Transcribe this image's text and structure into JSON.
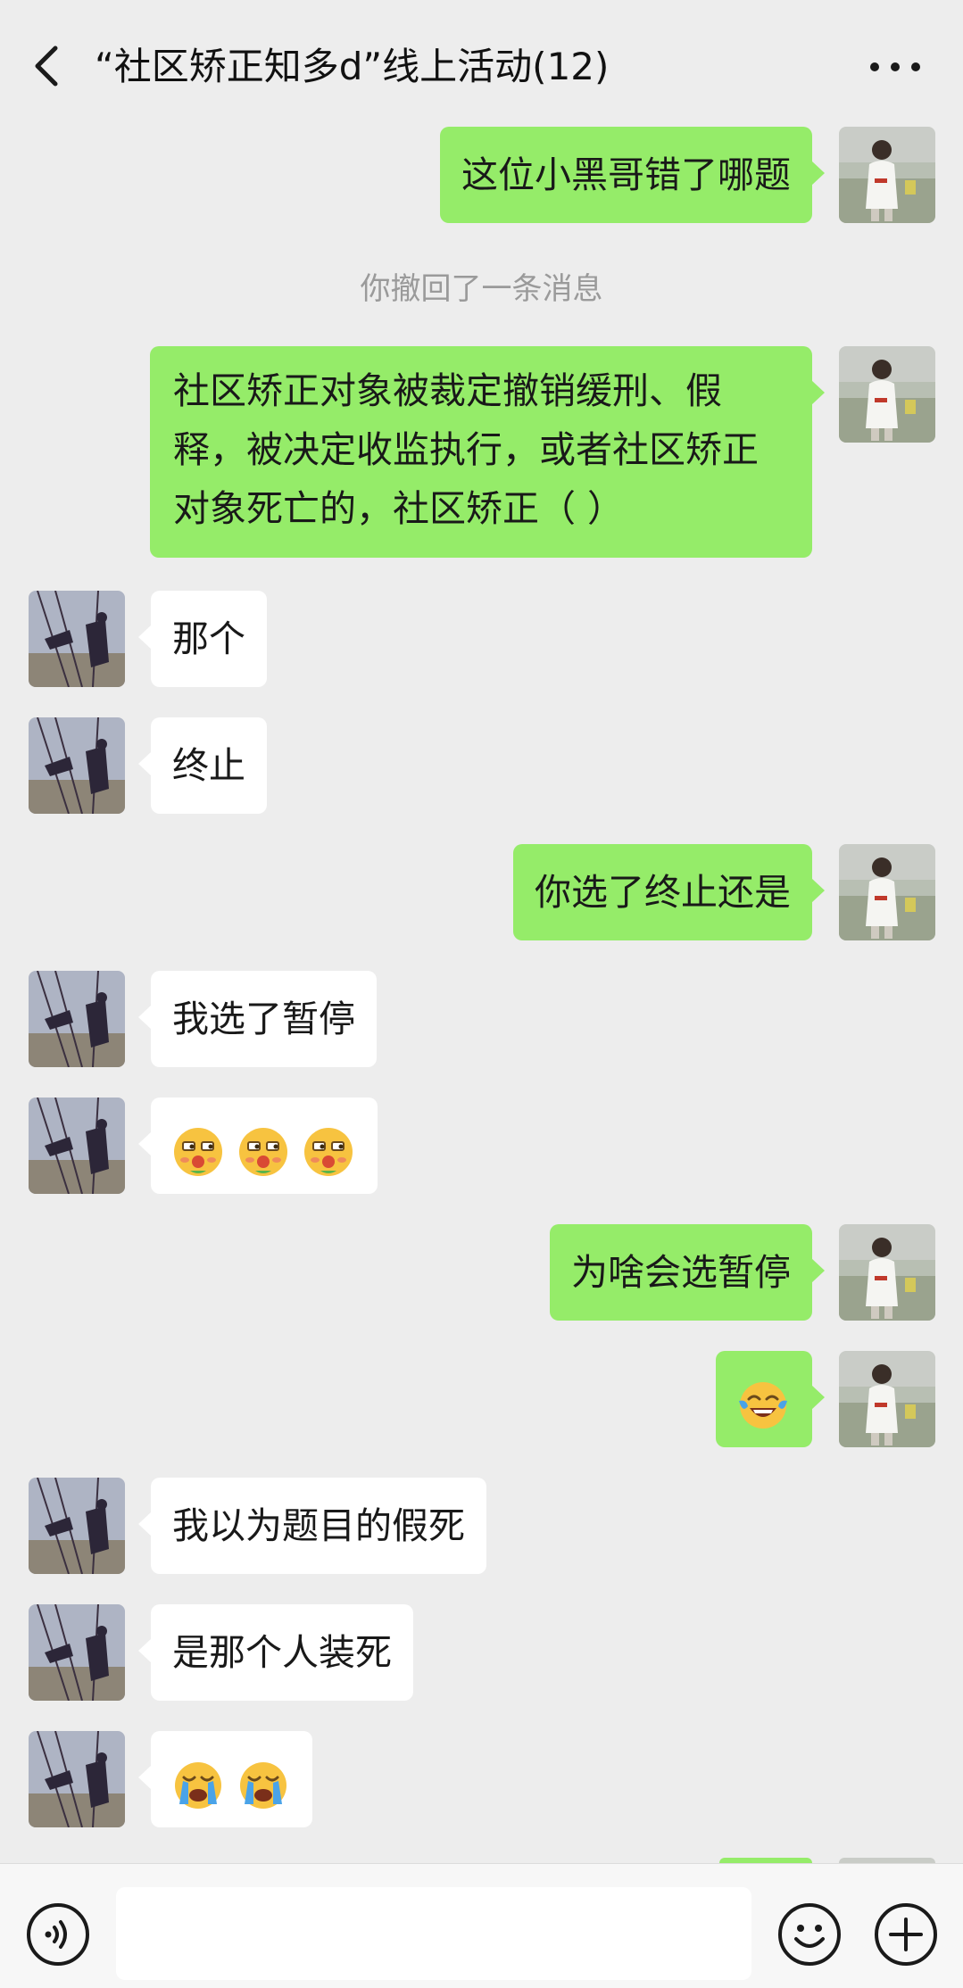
{
  "header": {
    "title": "“社区矫正知多d”线上活动(12)"
  },
  "messages": [
    {
      "from": "me",
      "text": "这位小黑哥错了哪题"
    },
    {
      "type": "system",
      "text": "你撤回了一条消息"
    },
    {
      "from": "me",
      "text": "社区矫正对象被裁定撤销缓刑、假释，被决定收监执行，或者社区矫正对象死亡的，社区矫正（ ）"
    },
    {
      "from": "them",
      "text": "那个"
    },
    {
      "from": "them",
      "text": "终止"
    },
    {
      "from": "me",
      "text": "你选了终止还是"
    },
    {
      "from": "them",
      "text": "我选了暂停"
    },
    {
      "from": "them",
      "emoji": [
        "smirk-emoji",
        "smirk-emoji",
        "smirk-emoji"
      ]
    },
    {
      "from": "me",
      "text": "为啥会选暂停"
    },
    {
      "from": "me",
      "emoji": [
        "tears-of-joy-emoji"
      ]
    },
    {
      "from": "them",
      "text": "我以为题目的假死"
    },
    {
      "from": "them",
      "text": "是那个人装死"
    },
    {
      "from": "them",
      "emoji": [
        "sob-emoji",
        "sob-emoji"
      ]
    }
  ],
  "input": {
    "value": ""
  },
  "icons": {
    "back": "chevron-left-icon",
    "more": "more-dots-icon",
    "voice": "voice-icon",
    "emoji": "emoji-icon",
    "plus": "plus-icon"
  },
  "colors": {
    "background": "#ededed",
    "my_bubble": "#95ec69",
    "their_bubble": "#ffffff",
    "system_text": "#9a9a9a"
  }
}
